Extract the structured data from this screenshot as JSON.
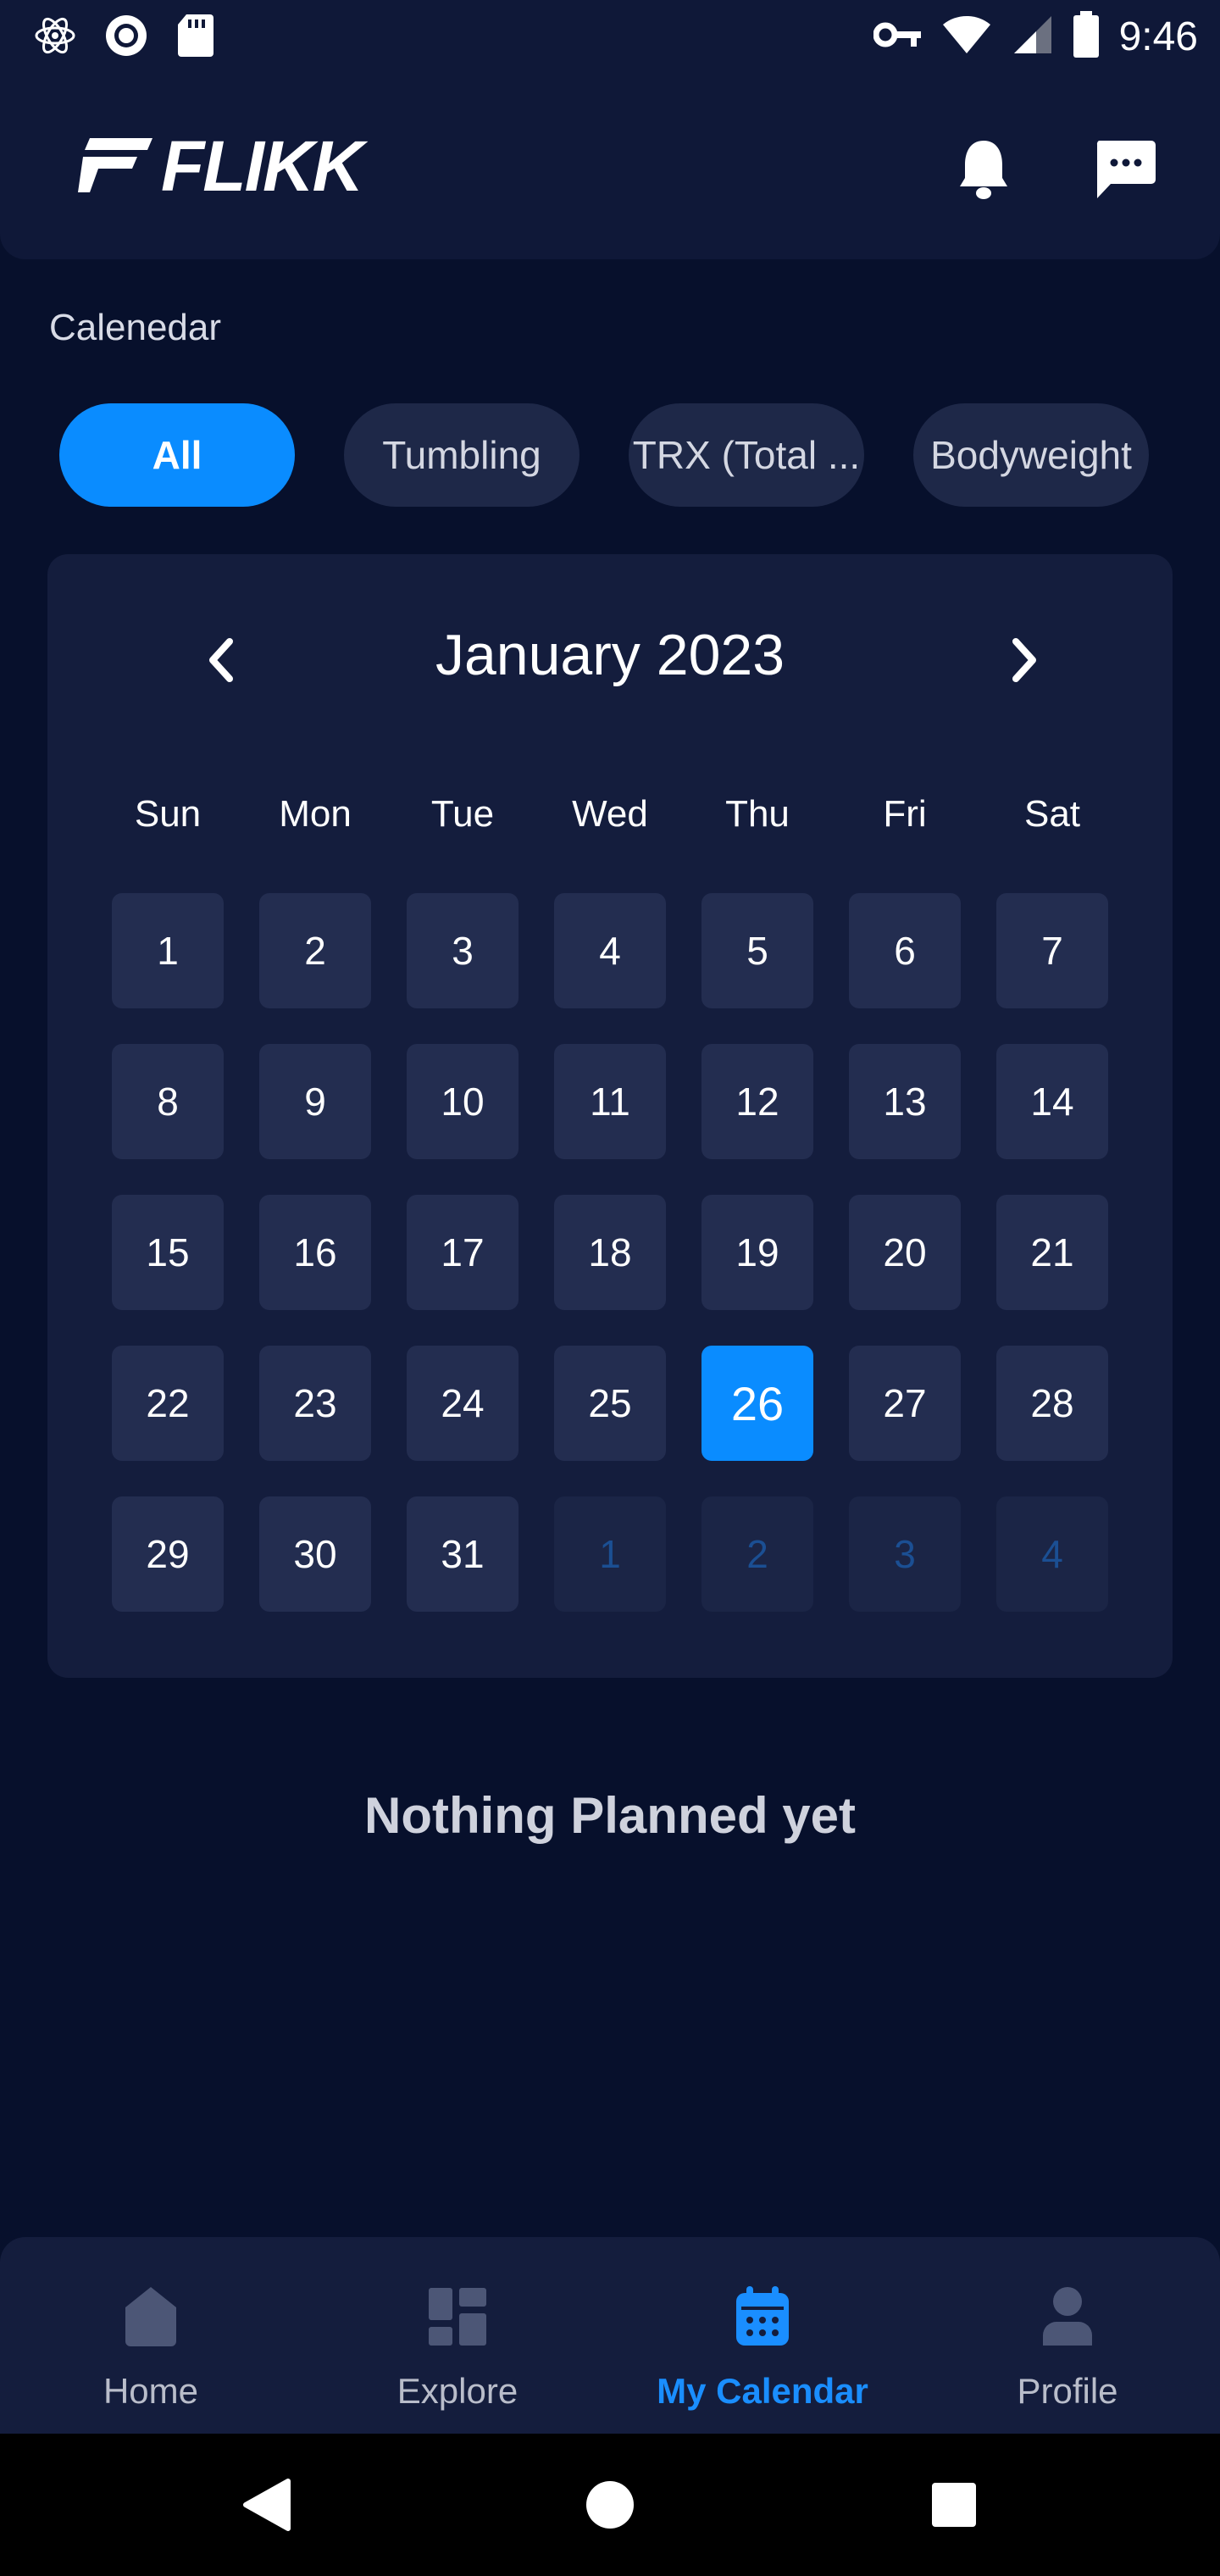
{
  "status_bar": {
    "time": "9:46",
    "left_icons": [
      "atom-icon",
      "record-icon",
      "sd-card-icon"
    ],
    "right_icons": [
      "vpn-key-icon",
      "wifi-icon",
      "signal-icon",
      "battery-icon"
    ]
  },
  "header": {
    "logo_text": "FLIKK",
    "icons": [
      "bell-icon",
      "chat-icon"
    ]
  },
  "section_title": "Calenedar",
  "filters": [
    {
      "label": "All",
      "active": true
    },
    {
      "label": "Tumbling",
      "active": false
    },
    {
      "label": "TRX (Total ...",
      "active": false
    },
    {
      "label": "Bodyweight",
      "active": false
    }
  ],
  "calendar": {
    "month_label": "January 2023",
    "weekdays": [
      "Sun",
      "Mon",
      "Tue",
      "Wed",
      "Thu",
      "Fri",
      "Sat"
    ],
    "weeks": [
      [
        "1",
        "2",
        "3",
        "4",
        "5",
        "6",
        "7"
      ],
      [
        "8",
        "9",
        "10",
        "11",
        "12",
        "13",
        "14"
      ],
      [
        "15",
        "16",
        "17",
        "18",
        "19",
        "20",
        "21"
      ],
      [
        "22",
        "23",
        "24",
        "25",
        "26",
        "27",
        "28"
      ],
      [
        "29",
        "30",
        "31",
        "1",
        "2",
        "3",
        "4"
      ]
    ],
    "selected_day": "26",
    "next_month_days": [
      "1",
      "2",
      "3",
      "4"
    ]
  },
  "empty_message": "Nothing Planned yet",
  "bottom_nav": [
    {
      "label": "Home",
      "icon": "home-icon",
      "active": false
    },
    {
      "label": "Explore",
      "icon": "grid-icon",
      "active": false
    },
    {
      "label": "My Calendar",
      "icon": "calendar-icon",
      "active": true
    },
    {
      "label": "Profile",
      "icon": "person-icon",
      "active": false
    }
  ],
  "colors": {
    "background": "#07102c",
    "surface": "#141d3d",
    "accent": "#0a8cff",
    "day_tile": "#232d50",
    "muted_text": "#1b4f93"
  }
}
